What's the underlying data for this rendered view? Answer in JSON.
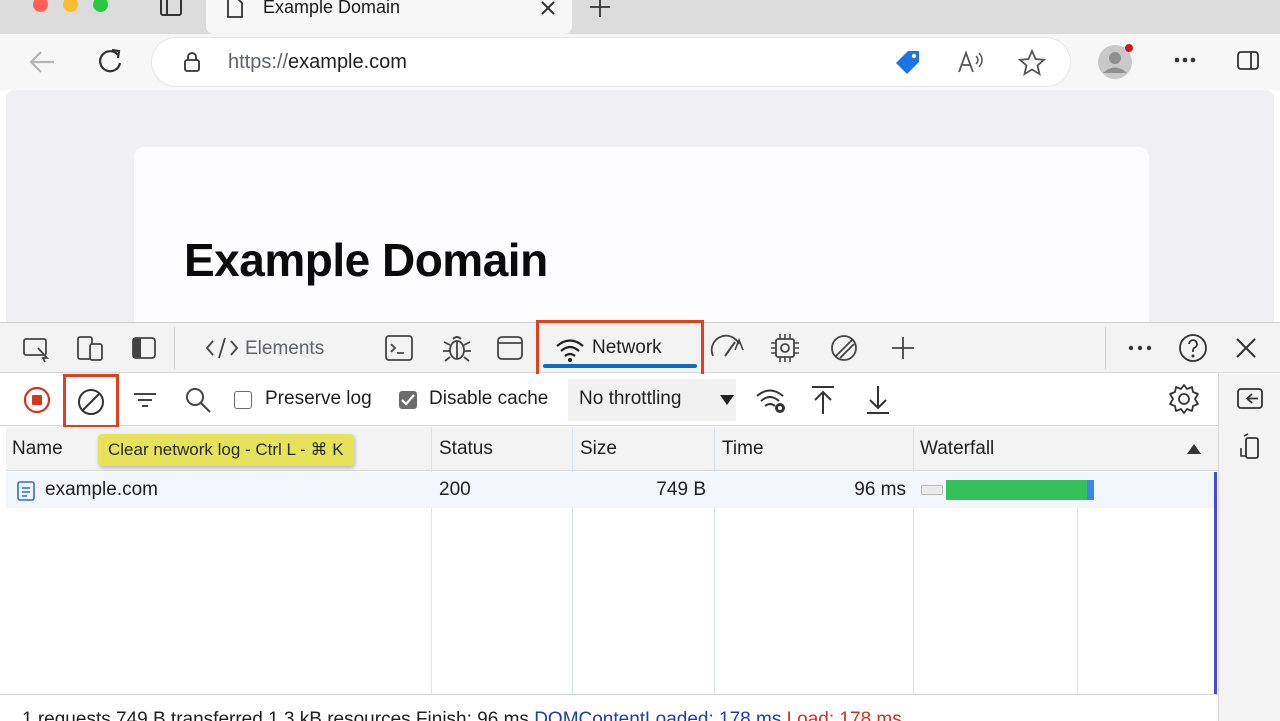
{
  "browser": {
    "tab_title": "Example Domain",
    "url_scheme": "https://",
    "url_host": "example.com"
  },
  "page": {
    "heading": "Example Domain"
  },
  "devtools": {
    "tabs": {
      "elements_label": "Elements",
      "network_label": "Network"
    },
    "network_toolbar": {
      "preserve_log_label": "Preserve log",
      "preserve_log_checked": false,
      "disable_cache_label": "Disable cache",
      "disable_cache_checked": true,
      "throttling_value": "No throttling"
    },
    "tooltip": "Clear network log - Ctrl L - ⌘ K",
    "table": {
      "columns": [
        "Name",
        "Status",
        "Size",
        "Time",
        "Waterfall"
      ],
      "rows": [
        {
          "name": "example.com",
          "status": "200",
          "size": "749 B",
          "time": "96 ms"
        }
      ]
    },
    "status_bar": {
      "summary": "1 requests  749 B transferred  1.3 kB resources  Finish: 96 ms  ",
      "dom_content_loaded": "DOMContentLoaded: 178 ms",
      "load": "Load: 178 ms"
    }
  },
  "colors": {
    "highlight_red": "#e2401c",
    "network_underline": "#0f6cbd",
    "waterfall_green": "#34c15a",
    "waterfall_blue": "#3a86f0",
    "tooltip_yellow": "#e6e35a"
  }
}
